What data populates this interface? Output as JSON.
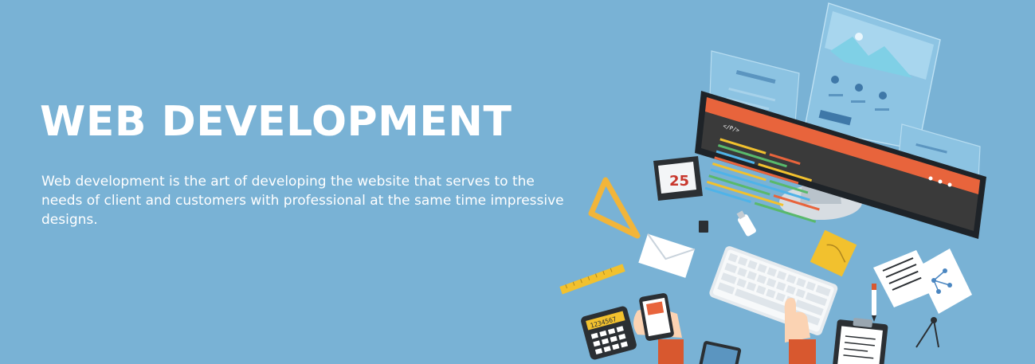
{
  "hero": {
    "title": "WEB DEVELOPMENT",
    "description": "Web development is the art of developing the website that serves to the needs of client and customers with professional at the same time impressive designs."
  },
  "illustration": {
    "calendar_day": "25",
    "code_tag": "</P/>",
    "calculator_display": "1234567"
  },
  "colors": {
    "background": "#79b2d5",
    "monitor_screen": "#3a3a3a",
    "screen_header": "#e8643c",
    "accent_orange": "#e8643c",
    "accent_yellow": "#f2c12e",
    "white": "#ffffff"
  },
  "icons": [
    "wireframe-panel-icon",
    "monitor-icon",
    "calendar-icon",
    "triangle-ruler-icon",
    "ruler-icon",
    "sd-card-icon",
    "usb-drive-icon",
    "envelope-icon",
    "sticky-note-icon",
    "keyboard-icon",
    "documents-icon",
    "pen-icon",
    "smartphone-icon",
    "calculator-icon",
    "tablet-icon",
    "clipboard-icon",
    "compass-icon",
    "hand-icon"
  ]
}
